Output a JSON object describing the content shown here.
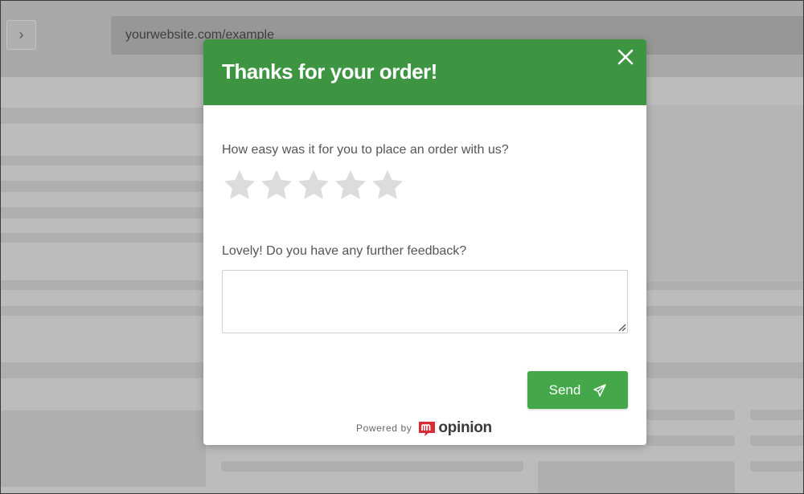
{
  "browser": {
    "back_icon": "chevron-right-icon",
    "address": "yourwebsite.com/example"
  },
  "modal": {
    "title": "Thanks for your order!",
    "close_icon": "close-icon",
    "question1": "How easy was it for you to place an order with us?",
    "rating": {
      "max": 5,
      "selected": 0
    },
    "question2": "Lovely! Do you have any further feedback?",
    "feedback_value": "",
    "send_label": "Send",
    "send_icon": "paper-plane-icon",
    "powered_by": "Powered by",
    "brand_name": "opinion",
    "brand_logo_icon": "mopinion-m-logo-icon"
  },
  "colors": {
    "header": "#3d9441",
    "send_button": "#44a84a",
    "star_empty": "#dcdcdc",
    "brand_red": "#d92b35"
  }
}
